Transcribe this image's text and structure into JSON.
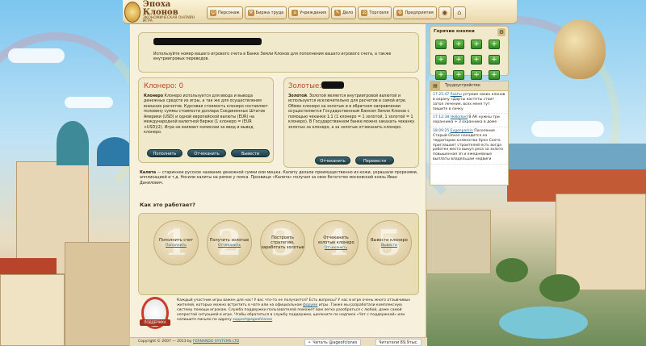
{
  "header": {
    "logo_title": "Эпоха Клонов",
    "logo_subtitle": "ЭКОНОМИЧЕСКАЯ ОНЛАЙН ИГРА",
    "nav": [
      {
        "label": "Персонаж",
        "icon": "person-icon"
      },
      {
        "label": "Биржа труда",
        "icon": "tools-icon"
      },
      {
        "label": "Учреждения",
        "icon": "institution-icon"
      },
      {
        "label": "Дело",
        "icon": "business-icon"
      },
      {
        "label": "Торговля",
        "icon": "trade-icon"
      },
      {
        "label": "Предприятия",
        "icon": "factory-icon"
      }
    ]
  },
  "account": {
    "intro": "Используйте номер вашего игрового счета в Банке Земли Клонов для пополнения вашего игрового счета, а также внутриигровых переводов."
  },
  "klonero": {
    "title": "Клонеро: 0",
    "term": "Клонеро",
    "description": " Клонеро используется для ввода и вывода денежных средств из игры, а так же для осуществления внешних расчетов. Курсовая стоимость клонеро составляет половину суммы стоимости доллара Соединенных Штатов Америки (USD) и одной европейской валюты (EUR) на международной валютной бирже (1 клонеро = (EUR +USD)/2). Игра не взимает комиссии за ввод и вывод клонеро.",
    "buttons": [
      "Пополнить",
      "Отчеканить",
      "Вывести"
    ]
  },
  "gold": {
    "title": "Золотые:",
    "term": "Золотой",
    "description": ". Золотой является внутриигровой валютой и используется исключительно для расчетов в самой игре. Обмен клонеро на золотые и в обратном направлении осуществляется Государственным Банком Земли Клонов с помощью чеканки 1:1 (1 клонеро = 1 золотой, 1 золотой = 1 клонеро). В Государственном банке можно заказать чеканку золотых за клонеро, а за золотые отчеканить клонеро.",
    "buttons": [
      "Отчеканить",
      "Перевести"
    ]
  },
  "kalita": {
    "term": "Калита",
    "text": " — старинное русское название денежной сумки или мешка. Калиту делали преимущественно из кожи, украшали прорезями, аппликацией и т.д. Носили калиты на ремне у пояса. Прозвище «Калита» получил за свое богатство московский князь Иван Данилович."
  },
  "how_it_works": {
    "title": "Как это работает?",
    "steps": [
      {
        "num": "1",
        "label": "Пополнить счет",
        "link": "Пополнить"
      },
      {
        "num": "2",
        "label": "Получить золотые",
        "link": "Отчеканить"
      },
      {
        "num": "3",
        "label": "Построить стратегию, заработать золотые",
        "link": ""
      },
      {
        "num": "4",
        "label": "Отчеканить золотые клонеро",
        "link": "Отчеканить"
      },
      {
        "num": "5",
        "label": "Вывести клонеро",
        "link": "Вывести"
      }
    ]
  },
  "support": {
    "badge": "ПОДДЕРЖКА",
    "text_before": "Каждый участник игры важен для нас! У вас что-то не получается? Есть вопросы? У нас в игре очень много отзывчивых жителей, которых можно встретить в чате или на официальном ",
    "forum_link": "форуме",
    "text_middle": " игры. Также мы разработали комплексную систему помощи игрокам. Служба поддержки пользователей поможет вам легко разобраться с любой, даже самой непростой ситуацией в игре. Чтобы обратиться в службу поддержки, щелкните по надписи «Чат с поддержкой» или напишите письмо по адресу ",
    "email": "support@ageofclones"
  },
  "footer": {
    "copyright": "Copyright © 2007 — 2013 by ",
    "company": "FERNANDO SYSTEMS LTD",
    "twitter_label": "Читать @ageofclones",
    "readers_label": "Читатели 89,9тыс."
  },
  "hot_buttons": {
    "title": "Горячие кнопки",
    "slots": [
      "+",
      "+",
      "+",
      "+",
      "+",
      "+",
      "+",
      "+",
      "+",
      "+",
      "+",
      "+"
    ]
  },
  "events": {
    "tab_label": "Трудоустройство",
    "items": [
      {
        "time": "17:21:47",
        "who": "Rukhu",
        "text": " устроил своих клонов в охрану «Дарты кастеты стоит затол лечение, всех меня тут пишите в личку"
      },
      {
        "time": "17:12:38",
        "who": "Hellorked",
        "text": " В АК нужны три охранника + 3 охранника в доме"
      },
      {
        "time": "18:09:25",
        "who": "Evgenparkin",
        "text": " Поселение Старый Оскол находится на территории княжества Хрен Сахта приглашает строителей есть вогда работке места выкуп реса за золото повышенная зп и ежедневные выплаты владельцам недвиги"
      }
    ]
  }
}
